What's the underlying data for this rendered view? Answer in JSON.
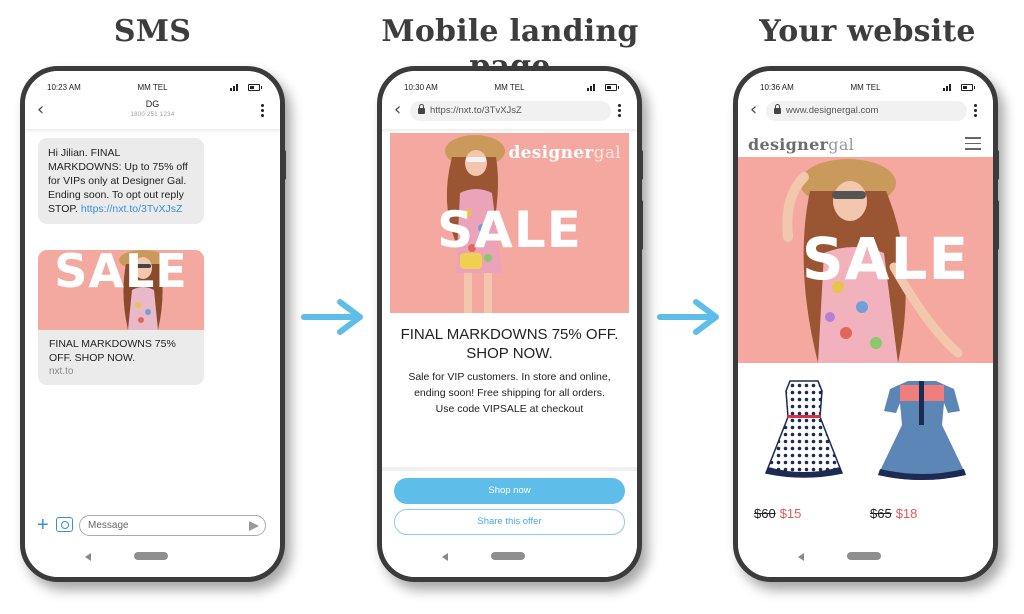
{
  "titles": {
    "sms": "SMS",
    "landing": "Mobile landing page",
    "website": "Your website"
  },
  "colors": {
    "accent_blue": "#5ebde9",
    "link_blue": "#3a8fd6",
    "hero_pink": "#f5a8a0",
    "sale_price": "#e05a5a",
    "frame": "#3b3b3b"
  },
  "sms_phone": {
    "status": {
      "time": "10:23 AM",
      "carrier": "MM TEL"
    },
    "header": {
      "contact": "DG",
      "number": "1800 251 1234",
      "back_icon": "chevron-left-icon",
      "menu_icon": "kebab-menu-icon"
    },
    "message": {
      "text": "Hi Jilian. FINAL MARKDOWNS: Up to 75% off for VIPs only at Designer Gal. Ending soon. To opt out reply STOP.",
      "link": "https://nxt.to/3TvXJsZ"
    },
    "mms": {
      "image_text": "SALE",
      "caption": "FINAL MARKDOWNS 75% OFF. SHOP NOW.",
      "domain": "nxt.to"
    },
    "composer": {
      "placeholder": "Message",
      "add_icon": "plus-icon",
      "camera_icon": "camera-icon",
      "send_icon": "send-icon"
    }
  },
  "landing_phone": {
    "status": {
      "time": "10:30 AM",
      "carrier": "MM TEL"
    },
    "url": "https://nxt.to/3TvXJsZ",
    "hero": {
      "brand": "designer",
      "brand_suffix": "gal",
      "sale_text": "SALE"
    },
    "headline": "FINAL MARKDOWNS 75% OFF. SHOP NOW.",
    "body_lines": [
      "Sale for VIP customers. In store and online,",
      "ending soon! Free shipping for all orders.",
      "Use code VIPSALE at checkout"
    ],
    "buttons": {
      "primary": "Shop now",
      "secondary": "Share this offer"
    }
  },
  "website_phone": {
    "status": {
      "time": "10:36 AM",
      "carrier": "MM TEL"
    },
    "url": "www.designergal.com",
    "brand": "designer",
    "brand_suffix": "gal",
    "hero": {
      "sale_text": "SALE"
    },
    "products": [
      {
        "name": "polka-dot dress",
        "old_price": "$60",
        "new_price": "$15"
      },
      {
        "name": "denim dress",
        "old_price": "$65",
        "new_price": "$18"
      }
    ]
  }
}
